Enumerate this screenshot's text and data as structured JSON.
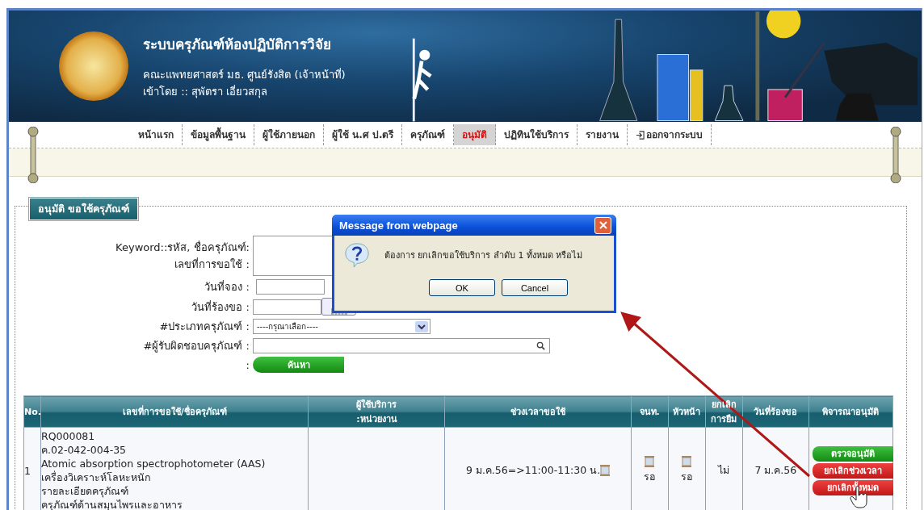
{
  "header": {
    "title": "ระบบครุภัณฑ์ห้องปฏิบัติการวิจัย",
    "subtitle": "คณะแพทยศาสตร์ มธ. ศูนย์รังสิต (เจ้าหน้าที่)",
    "login_line": "เข้าโดย :: สุพัตรา เอี่ยวสกุล"
  },
  "nav": {
    "items": [
      {
        "label": "หน้าแรก",
        "selected": false,
        "kind": "link"
      },
      {
        "label": "ข้อมูลพื้นฐาน",
        "selected": false,
        "kind": "link"
      },
      {
        "label": "ผู้ใช้ภายนอก",
        "selected": false,
        "kind": "link"
      },
      {
        "label": "ผู้ใช้ น.ศ ป.ตรี",
        "selected": false,
        "kind": "link"
      },
      {
        "label": "ครุภัณฑ์",
        "selected": false,
        "kind": "link"
      },
      {
        "label": "อนุมัติ",
        "selected": true,
        "kind": "link"
      },
      {
        "label": "ปฏิทินใช้บริการ",
        "selected": false,
        "kind": "link"
      },
      {
        "label": "รายงาน",
        "selected": false,
        "kind": "link"
      },
      {
        "label": "ออกจากระบบ",
        "selected": false,
        "kind": "logout"
      }
    ]
  },
  "section": {
    "title": "อนุมัติ ขอใช้ครุภัณฑ์"
  },
  "form": {
    "keyword_label": "Keyword::รหัส, ชื่อครุภัณฑ์:",
    "request_no_label": "เลขที่การขอใช้ :",
    "booking_date_label": "วันที่จอง :",
    "request_date_label": "วันที่ร้องขอ :",
    "type_label": "#ประเภทครุภัณฑ์ :",
    "type_value": "----กรุณาเลือก----",
    "responsible_label": "#ผู้รับผิดชอบครุภัณฑ์ :",
    "button_colon": ":",
    "search_button": "ค้นหา"
  },
  "table": {
    "columns": [
      {
        "lines": [
          "No."
        ]
      },
      {
        "lines": [
          "เลขที่การขอใช้/ชื่อครุภัณฑ์"
        ]
      },
      {
        "lines": [
          "ผู้ใช้บริการ",
          ":หน่วยงาน"
        ]
      },
      {
        "lines": [
          "ช่วงเวลาขอใช้"
        ]
      },
      {
        "lines": [
          "จนท."
        ]
      },
      {
        "lines": [
          "หัวหน้า"
        ]
      },
      {
        "lines": [
          "ยกเลิก",
          "การยืม"
        ]
      },
      {
        "lines": [
          "วันที่ร้องขอ"
        ]
      },
      {
        "lines": [
          "พิจารณาอนุมัติ"
        ]
      }
    ],
    "rows": [
      {
        "no": "1",
        "details": [
          "RQ000081",
          "ค.02-042-004-35",
          "Atomic absorption spectrophotometer (AAS)",
          "เครื่องวิเคราะห์โลหะหนัก",
          "รายละเอียดครุภัณฑ์",
          "ครุภัณฑ์ด้านสมุนไพรและอาหาร"
        ],
        "time": "9 ม.ค.56=>11:00-11:30 น.",
        "staff": "รอ",
        "head": "รอ",
        "cancelled": "ไม่",
        "request_date": "7 ม.ค.56",
        "actions": [
          {
            "label": "ตรวจอนุมัติ",
            "kind": "approve"
          },
          {
            "label": "ยกเลิกช่วงเวลา",
            "kind": "cancel"
          },
          {
            "label": "ยกเลิกทั้งหมด",
            "kind": "cancel"
          }
        ]
      }
    ]
  },
  "dialog": {
    "title": "Message from webpage",
    "message": "ต้องการ ยกเลิกขอใช้บริการ ลำดับ 1 ทั้งหมด หรือไม่",
    "buttons": [
      "OK",
      "Cancel"
    ]
  }
}
